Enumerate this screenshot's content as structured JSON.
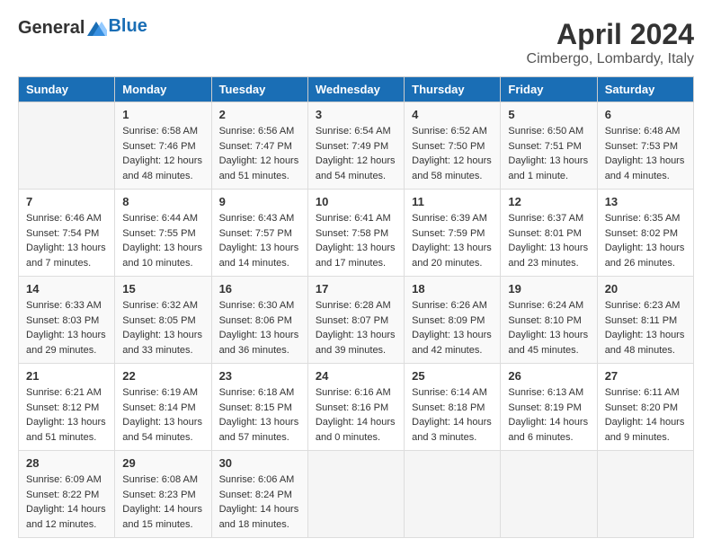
{
  "header": {
    "logo_general": "General",
    "logo_blue": "Blue",
    "month_title": "April 2024",
    "location": "Cimbergo, Lombardy, Italy"
  },
  "weekdays": [
    "Sunday",
    "Monday",
    "Tuesday",
    "Wednesday",
    "Thursday",
    "Friday",
    "Saturday"
  ],
  "weeks": [
    [
      {
        "day": "",
        "info": ""
      },
      {
        "day": "1",
        "info": "Sunrise: 6:58 AM\nSunset: 7:46 PM\nDaylight: 12 hours\nand 48 minutes."
      },
      {
        "day": "2",
        "info": "Sunrise: 6:56 AM\nSunset: 7:47 PM\nDaylight: 12 hours\nand 51 minutes."
      },
      {
        "day": "3",
        "info": "Sunrise: 6:54 AM\nSunset: 7:49 PM\nDaylight: 12 hours\nand 54 minutes."
      },
      {
        "day": "4",
        "info": "Sunrise: 6:52 AM\nSunset: 7:50 PM\nDaylight: 12 hours\nand 58 minutes."
      },
      {
        "day": "5",
        "info": "Sunrise: 6:50 AM\nSunset: 7:51 PM\nDaylight: 13 hours\nand 1 minute."
      },
      {
        "day": "6",
        "info": "Sunrise: 6:48 AM\nSunset: 7:53 PM\nDaylight: 13 hours\nand 4 minutes."
      }
    ],
    [
      {
        "day": "7",
        "info": "Sunrise: 6:46 AM\nSunset: 7:54 PM\nDaylight: 13 hours\nand 7 minutes."
      },
      {
        "day": "8",
        "info": "Sunrise: 6:44 AM\nSunset: 7:55 PM\nDaylight: 13 hours\nand 10 minutes."
      },
      {
        "day": "9",
        "info": "Sunrise: 6:43 AM\nSunset: 7:57 PM\nDaylight: 13 hours\nand 14 minutes."
      },
      {
        "day": "10",
        "info": "Sunrise: 6:41 AM\nSunset: 7:58 PM\nDaylight: 13 hours\nand 17 minutes."
      },
      {
        "day": "11",
        "info": "Sunrise: 6:39 AM\nSunset: 7:59 PM\nDaylight: 13 hours\nand 20 minutes."
      },
      {
        "day": "12",
        "info": "Sunrise: 6:37 AM\nSunset: 8:01 PM\nDaylight: 13 hours\nand 23 minutes."
      },
      {
        "day": "13",
        "info": "Sunrise: 6:35 AM\nSunset: 8:02 PM\nDaylight: 13 hours\nand 26 minutes."
      }
    ],
    [
      {
        "day": "14",
        "info": "Sunrise: 6:33 AM\nSunset: 8:03 PM\nDaylight: 13 hours\nand 29 minutes."
      },
      {
        "day": "15",
        "info": "Sunrise: 6:32 AM\nSunset: 8:05 PM\nDaylight: 13 hours\nand 33 minutes."
      },
      {
        "day": "16",
        "info": "Sunrise: 6:30 AM\nSunset: 8:06 PM\nDaylight: 13 hours\nand 36 minutes."
      },
      {
        "day": "17",
        "info": "Sunrise: 6:28 AM\nSunset: 8:07 PM\nDaylight: 13 hours\nand 39 minutes."
      },
      {
        "day": "18",
        "info": "Sunrise: 6:26 AM\nSunset: 8:09 PM\nDaylight: 13 hours\nand 42 minutes."
      },
      {
        "day": "19",
        "info": "Sunrise: 6:24 AM\nSunset: 8:10 PM\nDaylight: 13 hours\nand 45 minutes."
      },
      {
        "day": "20",
        "info": "Sunrise: 6:23 AM\nSunset: 8:11 PM\nDaylight: 13 hours\nand 48 minutes."
      }
    ],
    [
      {
        "day": "21",
        "info": "Sunrise: 6:21 AM\nSunset: 8:12 PM\nDaylight: 13 hours\nand 51 minutes."
      },
      {
        "day": "22",
        "info": "Sunrise: 6:19 AM\nSunset: 8:14 PM\nDaylight: 13 hours\nand 54 minutes."
      },
      {
        "day": "23",
        "info": "Sunrise: 6:18 AM\nSunset: 8:15 PM\nDaylight: 13 hours\nand 57 minutes."
      },
      {
        "day": "24",
        "info": "Sunrise: 6:16 AM\nSunset: 8:16 PM\nDaylight: 14 hours\nand 0 minutes."
      },
      {
        "day": "25",
        "info": "Sunrise: 6:14 AM\nSunset: 8:18 PM\nDaylight: 14 hours\nand 3 minutes."
      },
      {
        "day": "26",
        "info": "Sunrise: 6:13 AM\nSunset: 8:19 PM\nDaylight: 14 hours\nand 6 minutes."
      },
      {
        "day": "27",
        "info": "Sunrise: 6:11 AM\nSunset: 8:20 PM\nDaylight: 14 hours\nand 9 minutes."
      }
    ],
    [
      {
        "day": "28",
        "info": "Sunrise: 6:09 AM\nSunset: 8:22 PM\nDaylight: 14 hours\nand 12 minutes."
      },
      {
        "day": "29",
        "info": "Sunrise: 6:08 AM\nSunset: 8:23 PM\nDaylight: 14 hours\nand 15 minutes."
      },
      {
        "day": "30",
        "info": "Sunrise: 6:06 AM\nSunset: 8:24 PM\nDaylight: 14 hours\nand 18 minutes."
      },
      {
        "day": "",
        "info": ""
      },
      {
        "day": "",
        "info": ""
      },
      {
        "day": "",
        "info": ""
      },
      {
        "day": "",
        "info": ""
      }
    ]
  ]
}
